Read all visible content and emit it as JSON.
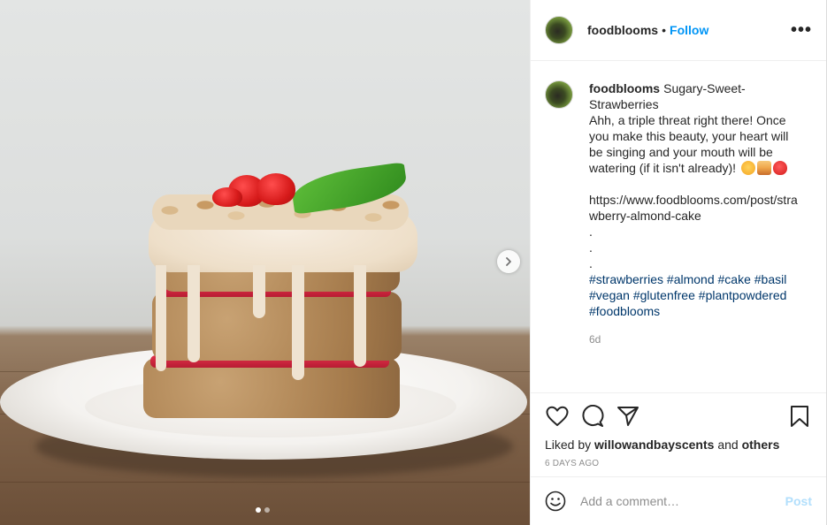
{
  "post": {
    "username": "foodblooms",
    "separator": "•",
    "follow_label": "Follow",
    "more_icon": "•••",
    "caption": {
      "username": "foodblooms",
      "title_line": "Sugary-Sweet-Strawberries",
      "body": "Ahh, a triple threat right there! Once you make this beauty, your heart will be singing and your mouth will be watering (if it isn't already)!",
      "emojis": [
        "smiling-face-emoji",
        "cake-emoji",
        "strawberry-emoji"
      ],
      "link": "https://www.foodblooms.com/post/strawberry-almond-cake",
      "dots": [
        ".",
        ".",
        "."
      ],
      "hashtags": [
        "#strawberries",
        "#almond",
        "#cake",
        "#basil",
        "#vegan",
        "#glutenfree",
        "#plantpowdered",
        "#foodblooms"
      ],
      "time": "6d"
    },
    "likes": {
      "prefix": "Liked by",
      "user": "willowandbayscents",
      "and": "and",
      "others": "others"
    },
    "date": "6 DAYS AGO",
    "comment_box": {
      "placeholder": "Add a comment…",
      "post_label": "Post"
    },
    "carousel": {
      "total_slides": 2,
      "active_slide": 1
    },
    "colors": {
      "link_blue": "#0095f6",
      "hashtag": "#00376b",
      "muted": "#8e8e8e",
      "post_disabled": "#b2dffc"
    }
  }
}
